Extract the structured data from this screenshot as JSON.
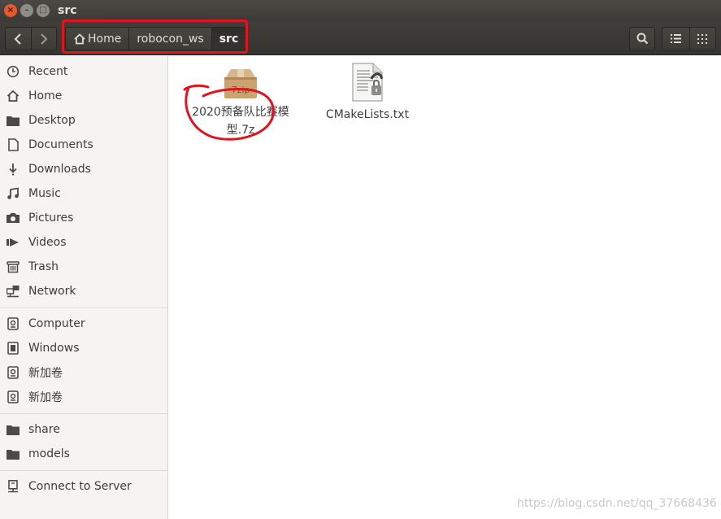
{
  "window": {
    "title": "src",
    "close_glyph": "×",
    "min_glyph": "–",
    "max_glyph": "□"
  },
  "pathbar": {
    "crumbs": [
      "Home",
      "robocon_ws",
      "src"
    ]
  },
  "sidebar": {
    "places": [
      {
        "label": "Recent",
        "icon": "clock-icon"
      },
      {
        "label": "Home",
        "icon": "home-icon"
      },
      {
        "label": "Desktop",
        "icon": "folder-icon"
      },
      {
        "label": "Documents",
        "icon": "document-icon"
      },
      {
        "label": "Downloads",
        "icon": "download-icon"
      },
      {
        "label": "Music",
        "icon": "music-icon"
      },
      {
        "label": "Pictures",
        "icon": "camera-icon"
      },
      {
        "label": "Videos",
        "icon": "video-icon"
      },
      {
        "label": "Trash",
        "icon": "trash-icon"
      },
      {
        "label": "Network",
        "icon": "network-icon"
      }
    ],
    "devices": [
      {
        "label": "Computer",
        "icon": "drive-icon"
      },
      {
        "label": "Windows",
        "icon": "chip-icon"
      },
      {
        "label": "新加卷",
        "icon": "drive-icon"
      },
      {
        "label": "新加卷",
        "icon": "drive-icon"
      }
    ],
    "bookmarks": [
      {
        "label": "share",
        "icon": "folder-icon"
      },
      {
        "label": "models",
        "icon": "folder-icon"
      }
    ],
    "other": [
      {
        "label": "Connect to Server",
        "icon": "server-icon"
      }
    ]
  },
  "files": [
    {
      "name_line1": "2020预备队比赛模",
      "name_line2": "型.7z",
      "icon": "archive-icon",
      "icon_label": "7zip"
    },
    {
      "name_line1": "CMakeLists.txt",
      "icon": "text-file-locked-icon"
    }
  ],
  "watermark": "https://blog.csdn.net/qq_37668436",
  "colors": {
    "annotation": "#e0141e",
    "titlebar": "#3b3a36",
    "sidebar": "#f5f4f2"
  }
}
